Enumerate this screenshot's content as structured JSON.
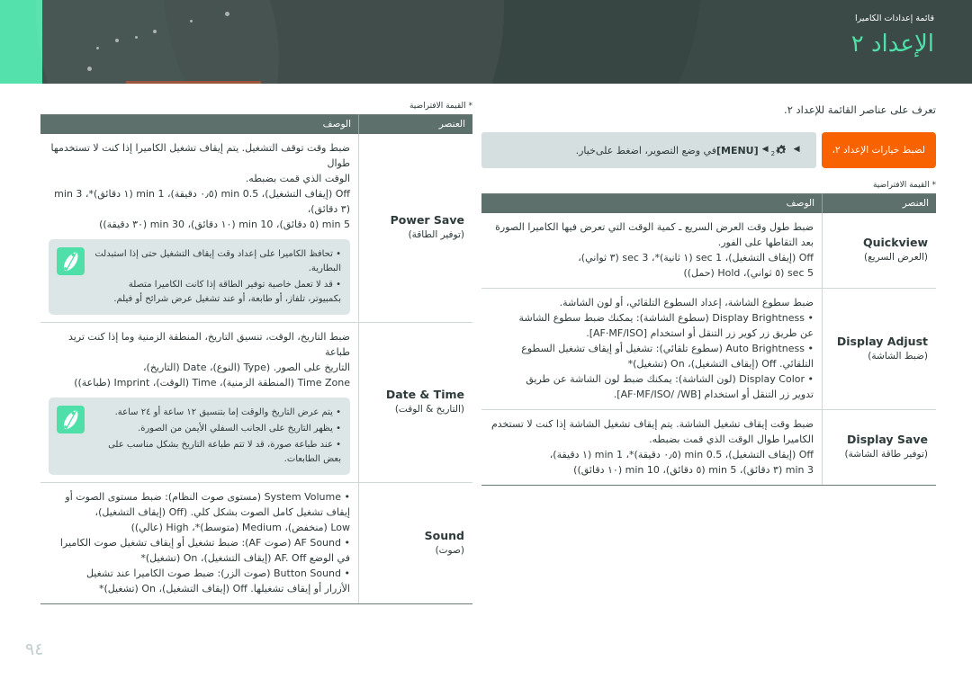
{
  "header": {
    "breadcrumb": "قائمة إعدادات الكاميرا",
    "title": "الإعداد ٢",
    "accent_color": "#4fe0a9",
    "bg_color": "#3b4a47"
  },
  "page_number": "٩٤",
  "intro": "تعرف على عناصر القائمة للإعداد ٢.",
  "pathbar": {
    "button_label": "لضبط خيارات الإعداد ٢،",
    "desc_prefix": "في وضع التصوير، اضغط على",
    "menu_key": "[MENU]",
    "gear_sub": "2",
    "option_label": "خيار.",
    "triangle": "◀",
    "button_color": "#f96200",
    "desc_bg": "#d5dfdf"
  },
  "footnote": "* القيمة الافتراضية",
  "table": {
    "col_item": "العنصر",
    "col_desc": "الوصف"
  },
  "right_rows": [
    {
      "item_en": "Quickview",
      "item_ar": "(العرض السريع)",
      "lines": [
        "ضبط طول وقت العرض السريع ـ كمية الوقت التي تعرض فيها الكاميرا الصورة",
        "بعد التقاطها على الفور.",
        "Off (إيقاف التشغيل)، sec 1 (١ ثانية)*، sec 3 (٣ ثواني)،",
        "sec 5 (٥ ثواني)، Hold (حمل))"
      ]
    },
    {
      "item_en": "Display Adjust",
      "item_ar": "(ضبط الشاشة)",
      "lines": [
        "ضبط سطوع الشاشة، إعداد السطوع التلقائي، أو لون الشاشة.",
        "• Display Brightness (سطوع الشاشة): يمكنك ضبط سطوع الشاشة",
        "عن طريق زر كوير زر التنقل أو استخدام [AF·MF/ISO].",
        "• Auto Brightness (سطوع تلقائي): تشغيل أو إيقاف تشغيل السطوع",
        "التلقائي. Off (إيقاف التشغيل)، On (تشغيل)*",
        "• Display Color (لون الشاشة): يمكنك ضبط لون الشاشة عن طريق",
        "تدوير زر التنقل أو استخدام [AF·MF/ISO/ /WB]."
      ]
    },
    {
      "item_en": "Display Save",
      "item_ar": "(توفير طاقة الشاشة)",
      "lines": [
        "ضبط وقت إيقاف تشغيل الشاشة. يتم إيقاف تشغيل الشاشة إذا كنت لا تستخدم",
        "الكاميرا طوال الوقت الذي قمت بضبطه.",
        "Off (إيقاف التشغيل)، min 0.5 (٠٫٥ دقيقة)*، min 1 (١ دقيقة)،",
        "min 3 (٣ دقائق)، min 5 (٥ دقائق)، min 10 (١٠ دقائق))"
      ]
    }
  ],
  "left_rows": [
    {
      "item_en": "Power Save",
      "item_ar": "(توفير الطاقة)",
      "lines": [
        "ضبط وقت توقف التشغيل. يتم إيقاف تشغيل الكاميرا إذا كنت لا تستخدمها طوال",
        "الوقت الذي قمت بضبطه.",
        "Off (إيقاف التشغيل)، min 0.5 (٠٫٥ دقيقة)، min 1 (١ دقائق)*، min 3 (٣ دقائق)،",
        "min 5 (٥ دقائق)، min 10 (١٠ دقائق)، min 30 (٣٠ دقيقة))"
      ],
      "note": [
        "• تحافظ الكاميرا على إعداد وقت إيقاف التشغيل حتى إذا استبدلت البطارية.",
        "• قد لا تعمل خاصية توفير الطاقة إذا كانت الكاميرا متصلة بكمبيوتر، تلفاز، أو طابعة، أو عند تشغيل عرض شرائح أو فيلم."
      ]
    },
    {
      "item_en": "Date & Time",
      "item_ar": "(التاريخ & الوقت)",
      "lines": [
        "ضبط التاريخ، الوقت، تنسيق التاريخ، المنطقة الزمنية وما إذا كنت تريد طباعة",
        "التاريخ على الصور. (Type (النوع)، Date (التاريخ)،",
        "Time Zone (المنطقة الزمنية)، Time (الوقت)، Imprint (طباعة))"
      ],
      "note": [
        "• يتم عرض التاريخ والوقت إما بتنسيق ١٢ ساعة أو ٢٤ ساعة.",
        "• يظهر التاريخ على الجانب السفلي الأيمن من الصورة.",
        "• عند طباعة صورة، قد لا تتم طباعة التاريخ بشكل مناسب على بعض الطابعات."
      ]
    },
    {
      "item_en": "Sound",
      "item_ar": "(صوت)",
      "lines": [
        "• System Volume (مستوى صوت النظام): ضبط مستوى الصوت أو",
        "إيقاف تشغيل كامل الصوت بشكل كلي. (Off (إيقاف التشغيل)،",
        "Low (منخفض)، Medium (متوسط)*، High (عالي))",
        "• AF Sound (صوت AF): ضبط تشغيل أو إيقاف تشغيل صوت الكاميرا",
        "في الوضع AF. Off (إيقاف التشغيل)، On (تشغيل)*",
        "• Button Sound (صوت الزر): ضبط صوت الكاميرا عند تشغيل",
        "الأزرار أو إيقاف تشغيلها. Off (إيقاف التشغيل)، On (تشغيل)*"
      ]
    }
  ]
}
